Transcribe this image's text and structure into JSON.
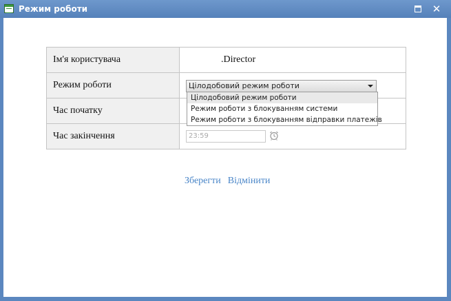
{
  "window": {
    "title": "Режим роботи",
    "icons": {
      "app": "form-window-icon",
      "maximize": "maximize-icon",
      "close": "close-icon"
    }
  },
  "form": {
    "rows": [
      {
        "label": "Ім'я користувача",
        "value": ".Director"
      },
      {
        "label": "Режим роботи",
        "value": "Цілодобовий режим роботи"
      },
      {
        "label": "Час початку",
        "value": ""
      },
      {
        "label": "Час закінчення",
        "value": "23:59"
      }
    ],
    "mode_options": [
      "Цілодобовий режим роботи",
      "Режим роботи з блокуванням системи",
      "Режим роботи з блокуванням відправки платежів"
    ],
    "clock_icon": "alarm-clock-icon"
  },
  "actions": {
    "save_label": "Зберегти",
    "cancel_label": "Відмінити"
  },
  "colors": {
    "titlebar": "#5b87bf",
    "link": "#4a86c8",
    "label_bg": "#f0f0f0"
  }
}
